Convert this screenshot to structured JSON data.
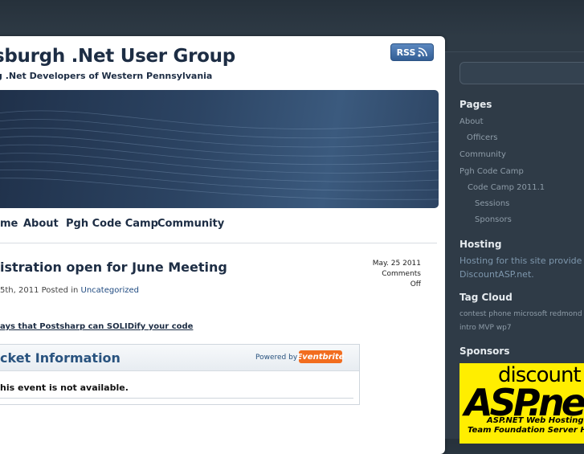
{
  "header": {
    "site_title": "sburgh .Net User Group",
    "site_description": "g .Net Developers of Western Pennsylvania",
    "rss_label": "RSS"
  },
  "nav": {
    "items": [
      "me",
      "About",
      "Pgh Code Camp",
      "Community"
    ]
  },
  "post": {
    "title": "istration open for June Meeting",
    "date": "May. 25 2011",
    "comments": "Comments Off",
    "meta_prefix": "5th, 2011 Posted in",
    "category": "Uncategorized",
    "link_text": "ays that Postsharp can SOLIDify your code"
  },
  "ticket": {
    "title": "cket Information",
    "powered_by": "Powered by",
    "eventbrite_logo": "Eventbrite",
    "message": "his event is not available."
  },
  "sidebar": {
    "pages_heading": "Pages",
    "pages": [
      "About",
      "Officers",
      "Community",
      "Pgh Code Camp",
      "Code Camp 2011.1",
      "Sessions",
      "Sponsors"
    ],
    "hosting_heading": "Hosting",
    "hosting_text_line1": "Hosting for this site provide",
    "hosting_text_line2": "DiscountASP.net.",
    "tag_cloud_heading": "Tag Cloud",
    "tags_line1": "contest phone microsoft redmond c",
    "tags_line2": "intro MVP wp7",
    "sponsors_heading": "Sponsors",
    "ad_discount": "discount",
    "ad_asp": "ASP.ne",
    "ad_line1": "ASP.NET Web Hosting",
    "ad_line2": "Team Foundation Server Hos"
  },
  "colors": {
    "page_bg": "#2b3640",
    "title_navy": "#1d2d44",
    "link_blue": "#29537f",
    "eventbrite_orange": "#f26d1f",
    "sponsor_yellow": "#ffee00"
  }
}
